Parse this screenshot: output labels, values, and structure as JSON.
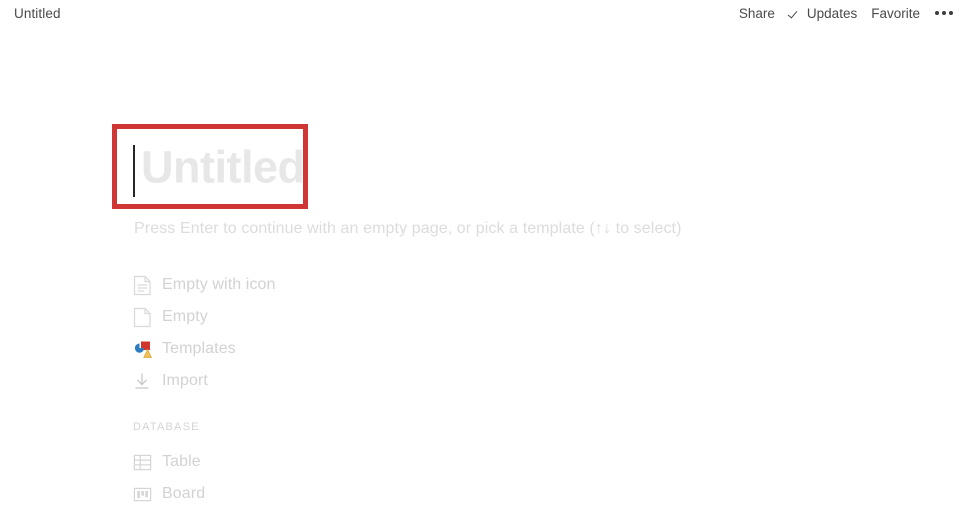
{
  "topbar": {
    "doc_title": "Untitled",
    "actions": [
      {
        "label": "Share",
        "icon": ""
      },
      {
        "label": "Updates",
        "icon": "check-icon"
      },
      {
        "label": "Favorite",
        "icon": ""
      }
    ],
    "more_icon": "ellipsis-icon"
  },
  "title": {
    "placeholder": "Untitled",
    "value": "",
    "highlight_color": "#cf3734",
    "caret_visible": true
  },
  "hint": "Press Enter to continue with an empty page, or pick a template (↑↓ to select)",
  "options": [
    {
      "label": "Empty with icon",
      "icon": "document-lines-icon"
    },
    {
      "label": "Empty",
      "icon": "document-blank-icon"
    },
    {
      "label": "Templates",
      "icon": "templates-icon"
    },
    {
      "label": "Import",
      "icon": "import-download-icon"
    }
  ],
  "database_section": {
    "header": "DATABASE",
    "items": [
      {
        "label": "Table",
        "icon": "table-grid-icon"
      },
      {
        "label": "Board",
        "icon": "board-kanban-icon"
      }
    ]
  },
  "colors": {
    "accent_red": "#cf3734",
    "placeholder_gray": "#e7e7e7",
    "muted_text": "#d2d2d2",
    "topbar_text": "#4a4a4a",
    "background": "#ffffff"
  }
}
